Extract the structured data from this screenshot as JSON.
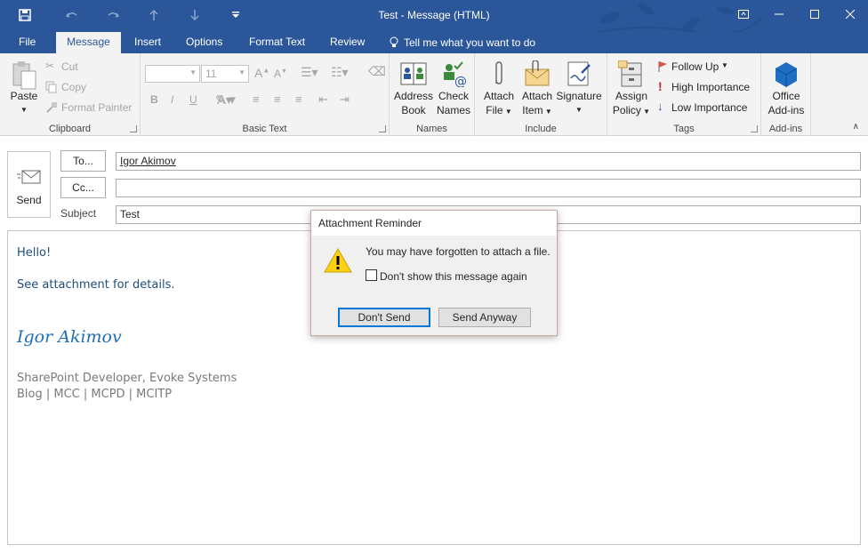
{
  "window": {
    "title": "Test - Message (HTML)"
  },
  "tabs": [
    "File",
    "Message",
    "Insert",
    "Options",
    "Format Text",
    "Review"
  ],
  "tell_me": "Tell me what you want to do",
  "ribbon": {
    "clipboard": {
      "paste": "Paste",
      "cut": "Cut",
      "copy": "Copy",
      "format_painter": "Format Painter",
      "label": "Clipboard"
    },
    "basic_text": {
      "font_size": "11",
      "label": "Basic Text"
    },
    "names": {
      "address": "Address",
      "book": "Book",
      "check": "Check",
      "names": "Names",
      "label": "Names"
    },
    "include": {
      "attach": "Attach",
      "file": "File",
      "item": "Item",
      "signature": "Signature",
      "label": "Include"
    },
    "tags": {
      "assign": "Assign",
      "policy": "Policy",
      "follow_up": "Follow Up",
      "high": "High Importance",
      "low": "Low Importance",
      "label": "Tags"
    },
    "addins": {
      "office": "Office",
      "addins": "Add-ins",
      "label": "Add-ins"
    }
  },
  "compose": {
    "send": "Send",
    "to_btn": "To...",
    "cc_btn": "Cc...",
    "subject_label": "Subject",
    "to_value": "Igor Akimov",
    "cc_value": "",
    "subject_value": "Test"
  },
  "body": {
    "greeting": "Hello!",
    "line": "See attachment for details.",
    "signature_name": "Igor Akimov",
    "title_line": "SharePoint Developer, Evoke Systems",
    "links": "Blog | MCC | MCPD | MCITP"
  },
  "dialog": {
    "title": "Attachment Reminder",
    "message": "You may have forgotten to attach a file.",
    "checkbox": "Don't show this message again",
    "dont_send": "Don't Send",
    "send_anyway": "Send Anyway"
  },
  "colors": {
    "accent": "#2b579a",
    "body_text": "#1f4e79"
  }
}
